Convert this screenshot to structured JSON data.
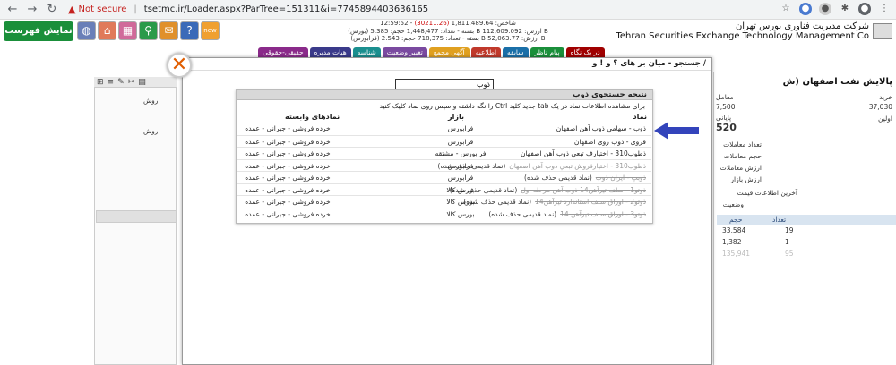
{
  "browser": {
    "not_secure": "Not secure",
    "url": "tsetmc.ir/Loader.aspx?ParTree=151311&i=7745894403636165"
  },
  "header": {
    "list_button": "نمایش فهرست",
    "ticker_line1_pre": "12:59:52 - شاخص: 1,811,489.64 ",
    "ticker_line1_red": "(30211.26)",
    "ticker_line2": "(بورس) بسته - تعداد: 1,448,477 حجم: 5.385 B ارزش: 112,609.092 B",
    "ticker_line3": "(فرابورس) بسته - تعداد: 718,375 حجم: 2.543 B ارزش: 52,063.77 B",
    "company_fa": "شرکت مدیریت فناوری بورس تهران",
    "company_en": "Tehran Securities Exchange Technology Management Co"
  },
  "tabs": [
    {
      "label": "در یک نگاه",
      "color": "#a00000"
    },
    {
      "label": "پیام ناظر",
      "color": "#1a8f3a"
    },
    {
      "label": "سابقه",
      "color": "#1a6fa8"
    },
    {
      "label": "اطلاعیه",
      "color": "#c0392b"
    },
    {
      "label": "آگهی مجمع",
      "color": "#e0a020"
    },
    {
      "label": "تغییر وضعیت",
      "color": "#7a4aa0"
    },
    {
      "label": "شناسه",
      "color": "#1a8f8f"
    },
    {
      "label": "هیات مدیره",
      "color": "#3a3a8a"
    },
    {
      "label": "حقیقی-حقوقی",
      "color": "#8a2a8a"
    }
  ],
  "background": {
    "left_label1": "روش",
    "left_label2": "روش",
    "right_title": "پالایش نفت اصفهان (ش",
    "right_buy": "خرید",
    "right_buy_val": "37,030",
    "right_trade": "معامل",
    "right_trade_val": "7,500",
    "right_first": "اولین",
    "right_final": "پایانی",
    "right_final_val": "520",
    "right_count": "تعداد معاملات",
    "right_volume": "حجم معاملات",
    "right_value": "ارزش معاملات",
    "right_market": "ارزش بازار",
    "right_last_info": "آخرین اطلاعات قیمت",
    "right_status": "وضعیت",
    "th_count": "تعداد",
    "th_volume": "حجم",
    "rows": [
      {
        "count": "19",
        "volume": "33,584"
      },
      {
        "count": "1",
        "volume": "1,382"
      },
      {
        "count": "95",
        "volume": "135,941"
      }
    ]
  },
  "modal": {
    "title": "جستجو - میان بر های ؟ و ! و /",
    "search_value": "ذوب",
    "result_title": "نتیجه جستجوی ذوب",
    "hint": "برای مشاهده اطلاعات نماد در یک tab جدید کلید Ctrl را نگه داشته و سپس روی نماد کلیک کنید",
    "col_symbol": "نماد",
    "col_market": "بازار",
    "col_related": "نمادهای وابسته",
    "results": [
      {
        "name": "ذوب - سهامي ذوب آهن اصفهان",
        "strike": "",
        "market": "فرابورس",
        "related": "خرده فروشی - جبرانی - عمده",
        "deleted": false
      },
      {
        "name": "فروی - ذوب روی اصفهان",
        "strike": "",
        "market": "فرابورس",
        "related": "خرده فروشی - جبرانی - عمده",
        "deleted": false
      },
      {
        "name": "ذطوب310 - اختيارف تبعي ذوب آهن اصفهان",
        "strike": "",
        "market": "فرابورس - مشتقه",
        "related": "خرده فروشی - جبرانی - عمده",
        "deleted": false
      },
      {
        "name": "(نماد قدیمی حذف شده)",
        "strike": "ذطوب310 - اختيارفروش تبعي ذوب آهن اصفهان",
        "market": "فرابورس",
        "related": "خرده فروشی - جبرانی - عمده",
        "deleted": true
      },
      {
        "name": "(نماد قدیمی حذف شده)",
        "strike": "ذوبپ - ايران ذوب",
        "market": "فرابورس",
        "related": "خرده فروشی - جبرانی - عمده",
        "deleted": true
      },
      {
        "name": "(نماد قدیمی حذف شده)",
        "strike": "ذوتو1 - سلف تيرآهن14 ذوب آهن مرحله اول",
        "market": "بورس کالا",
        "related": "خرده فروشی - جبرانی - عمده",
        "deleted": true
      },
      {
        "name": "(نماد قدیمی حذف شده)",
        "strike": "ذوتو2 - اوراق سلف استاندارد تيرآهن14",
        "market": "بورس کالا",
        "related": "خرده فروشی - جبرانی - عمده",
        "deleted": true
      },
      {
        "name": "(نماد قدیمی حذف شده)",
        "strike": "ذوتو3 - اوراق سلف تيرآهن 14",
        "market": "بورس کالا",
        "related": "خرده فروشی - جبرانی - عمده",
        "deleted": true
      }
    ]
  }
}
